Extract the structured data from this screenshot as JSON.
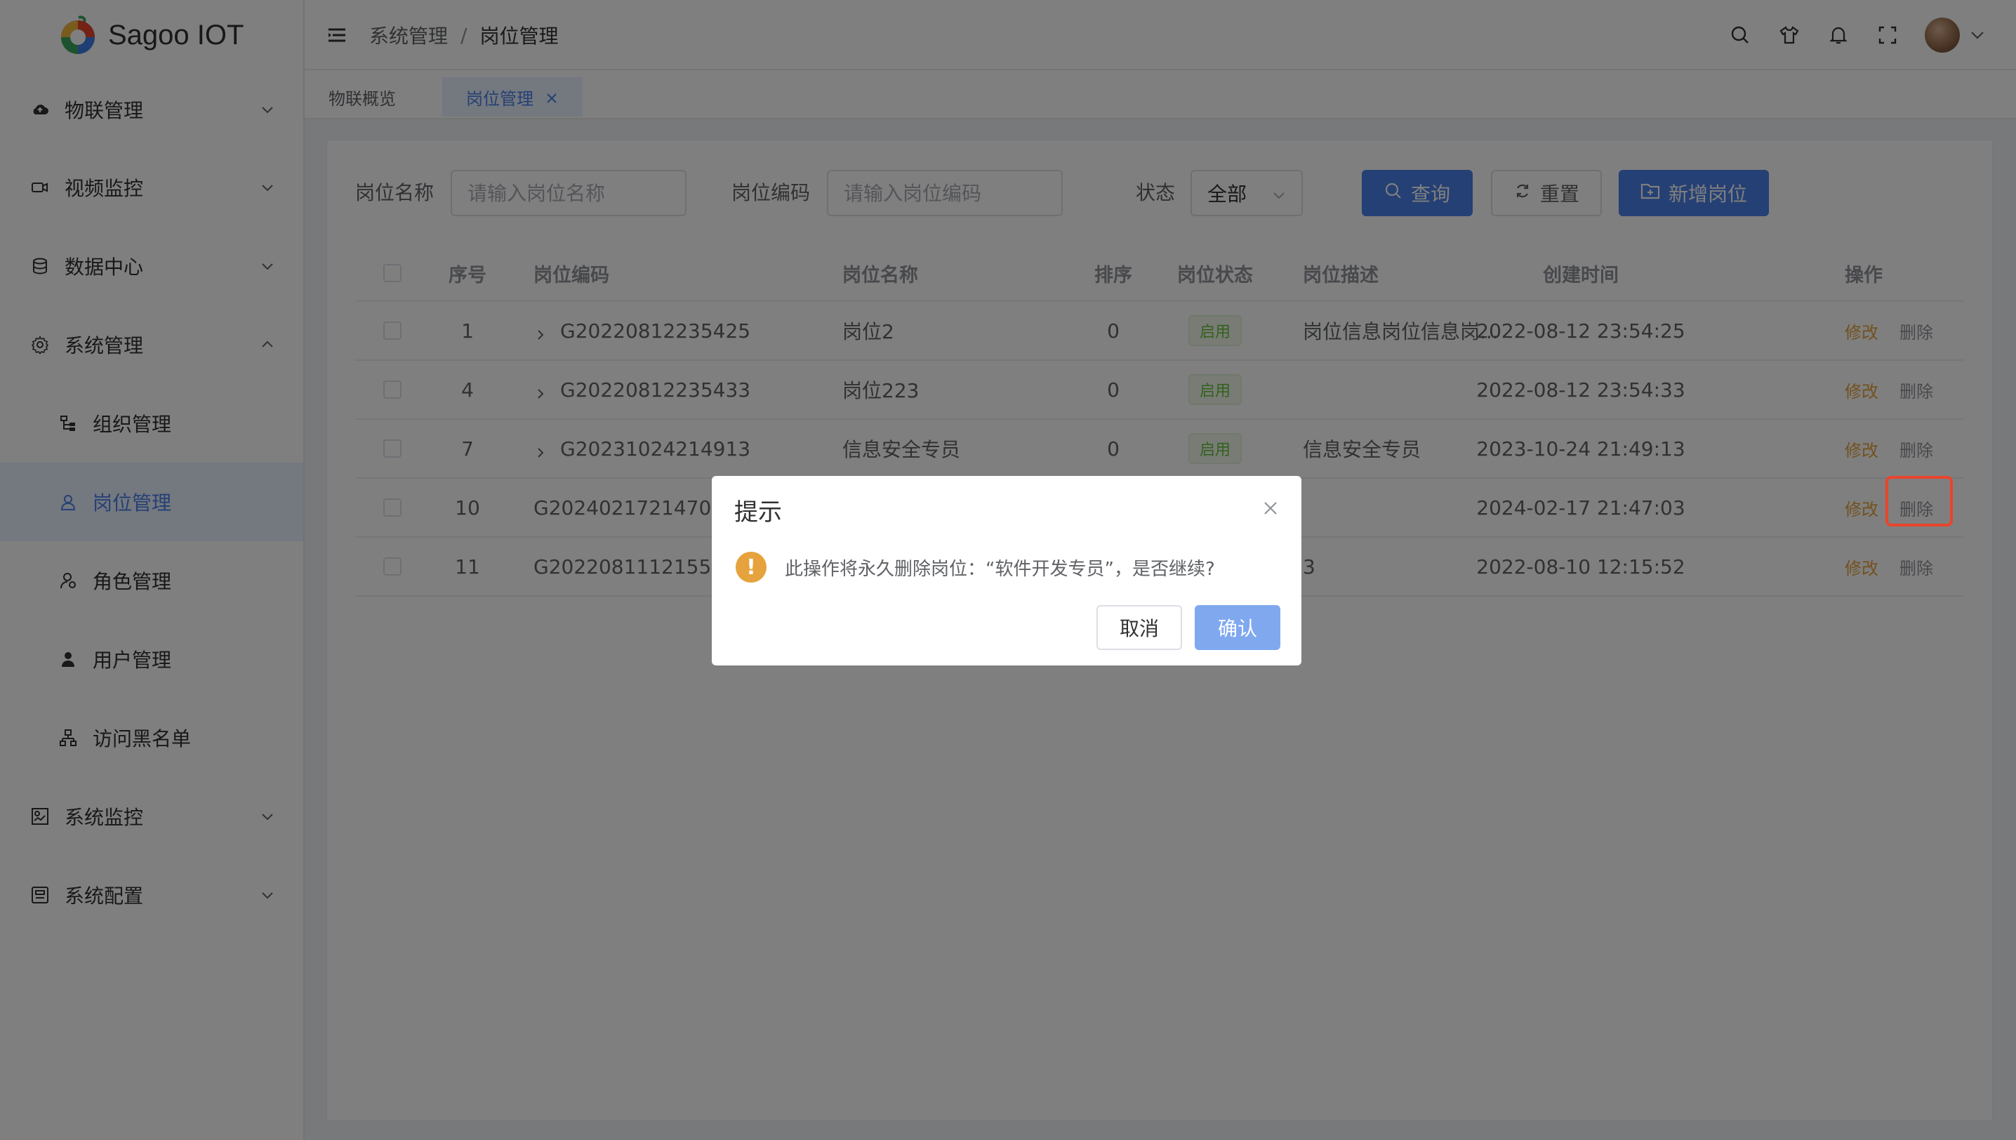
{
  "app": {
    "title": "Sagoo IOT"
  },
  "sidebar": {
    "items": [
      {
        "label": "物联管理",
        "icon": "cloud-icon",
        "expandable": true
      },
      {
        "label": "视频监控",
        "icon": "camera-icon",
        "expandable": true
      },
      {
        "label": "数据中心",
        "icon": "database-icon",
        "expandable": true
      },
      {
        "label": "系统管理",
        "icon": "gear-icon",
        "expandable": true,
        "expanded": true
      },
      {
        "label": "组织管理",
        "icon": "org-icon",
        "sub": true
      },
      {
        "label": "岗位管理",
        "icon": "user-outline-icon",
        "sub": true,
        "active": true
      },
      {
        "label": "角色管理",
        "icon": "role-icon",
        "sub": true
      },
      {
        "label": "用户管理",
        "icon": "user-icon",
        "sub": true
      },
      {
        "label": "访问黑名单",
        "icon": "blacklist-icon",
        "sub": true
      },
      {
        "label": "系统监控",
        "icon": "monitor-icon",
        "expandable": true
      },
      {
        "label": "系统配置",
        "icon": "config-icon",
        "expandable": true
      }
    ]
  },
  "header": {
    "breadcrumb": [
      "系统管理",
      "岗位管理"
    ],
    "separator": "/"
  },
  "tabs": [
    {
      "label": "物联概览"
    },
    {
      "label": "岗位管理",
      "active": true
    }
  ],
  "search": {
    "post_name_label": "岗位名称",
    "post_name_placeholder": "请输入岗位名称",
    "post_code_label": "岗位编码",
    "post_code_placeholder": "请输入岗位编码",
    "status_label": "状态",
    "status_value": "全部",
    "query_button": "查询",
    "reset_button": "重置",
    "add_button": "新增岗位"
  },
  "table": {
    "headers": {
      "seq": "序号",
      "code": "岗位编码",
      "name": "岗位名称",
      "sort": "排序",
      "status": "岗位状态",
      "desc": "岗位描述",
      "created": "创建时间",
      "actions": "操作"
    },
    "edit_label": "修改",
    "delete_label": "删除",
    "rows": [
      {
        "seq": "1",
        "code": "G20220812235425",
        "name": "岗位2",
        "sort": "0",
        "status": "启用",
        "desc": "岗位信息岗位信息岗...",
        "created": "2022-08-12 23:54:25",
        "expandable": true
      },
      {
        "seq": "4",
        "code": "G20220812235433",
        "name": "岗位223",
        "sort": "0",
        "status": "启用",
        "desc": "",
        "created": "2022-08-12 23:54:33",
        "expandable": true
      },
      {
        "seq": "7",
        "code": "G20231024214913",
        "name": "信息安全专员",
        "sort": "0",
        "status": "启用",
        "desc": "信息安全专员",
        "created": "2023-10-24 21:49:13",
        "expandable": true
      },
      {
        "seq": "10",
        "code": "G20240217214703",
        "name": "",
        "sort": "",
        "status": "",
        "desc": "",
        "created": "2024-02-17 21:47:03",
        "expandable": false
      },
      {
        "seq": "11",
        "code": "G20220811121552",
        "name": "",
        "sort": "",
        "status": "",
        "desc": "3",
        "created": "2022-08-10 12:15:52",
        "expandable": false
      }
    ]
  },
  "modal": {
    "title": "提示",
    "message": "此操作将永久删除岗位：“软件开发专员”，是否继续?",
    "cancel": "取消",
    "confirm": "确认"
  },
  "colors": {
    "primary": "#4a80e8",
    "warning": "#e6a23c",
    "success": "#67c23a",
    "highlight": "#e8452c"
  }
}
